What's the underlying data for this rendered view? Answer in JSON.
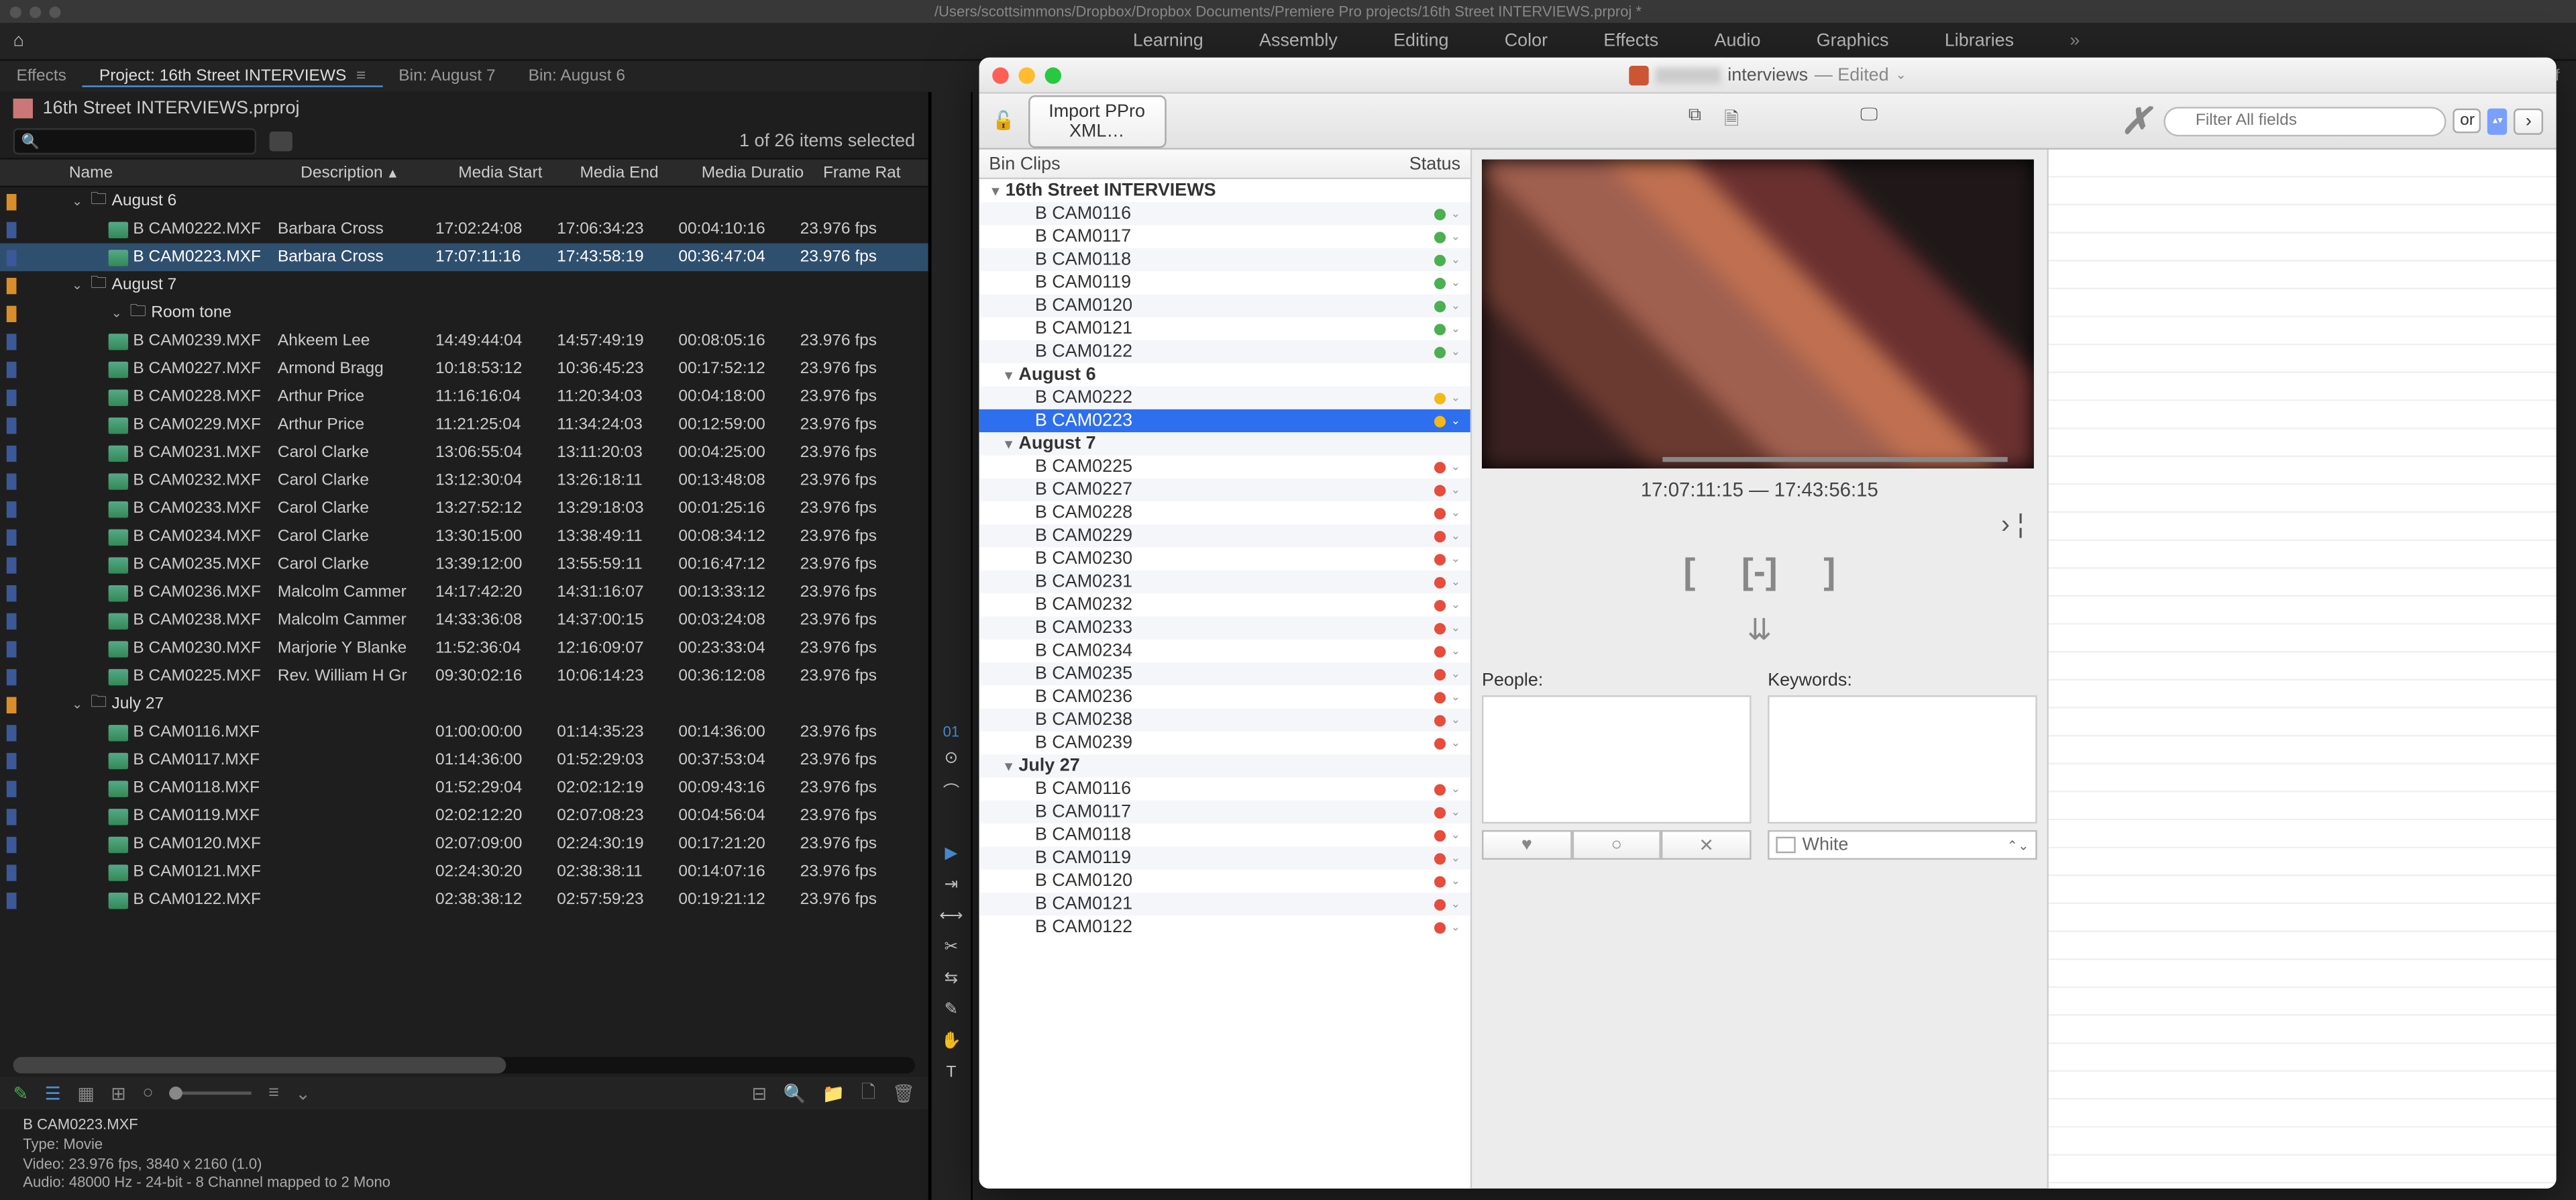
{
  "mac_title": "/Users/scottsimmons/Dropbox/Dropbox Documents/Premiere Pro projects/16th Street INTERVIEWS.prproj *",
  "nav": {
    "items": [
      "Learning",
      "Assembly",
      "Editing",
      "Color",
      "Effects",
      "Audio",
      "Graphics",
      "Libraries"
    ]
  },
  "tabs": {
    "effects": "Effects",
    "project": "Project: 16th Street INTERVIEWS",
    "bin1": "Bin: August 7",
    "bin2": "Bin: August 6",
    "eff_right": "Eff"
  },
  "project_name": "16th Street INTERVIEWS.prproj",
  "selection": "1 of 26 items selected",
  "columns": {
    "name": "Name",
    "desc": "Description",
    "start": "Media Start",
    "end": "Media End",
    "dur": "Media Duratio",
    "rate": "Frame Rat"
  },
  "rows": [
    {
      "type": "folder",
      "depth": 1,
      "name": "August 6",
      "label": "orange"
    },
    {
      "type": "clip",
      "depth": 2,
      "name": "B CAM0222.MXF",
      "desc": "Barbara Cross",
      "start": "17:02:24:08",
      "end": "17:06:34:23",
      "dur": "00:04:10:16",
      "rate": "23.976 fps"
    },
    {
      "type": "clip",
      "depth": 2,
      "name": "B CAM0223.MXF",
      "desc": "Barbara Cross",
      "start": "17:07:11:16",
      "end": "17:43:58:19",
      "dur": "00:36:47:04",
      "rate": "23.976 fps",
      "selected": true
    },
    {
      "type": "folder",
      "depth": 1,
      "name": "August 7",
      "label": "orange"
    },
    {
      "type": "folder",
      "depth": 2,
      "name": "Room tone",
      "label": "orange"
    },
    {
      "type": "clip",
      "depth": 2,
      "name": "B CAM0239.MXF",
      "desc": "Ahkeem Lee",
      "start": "14:49:44:04",
      "end": "14:57:49:19",
      "dur": "00:08:05:16",
      "rate": "23.976 fps"
    },
    {
      "type": "clip",
      "depth": 2,
      "name": "B CAM0227.MXF",
      "desc": "Armond Bragg",
      "start": "10:18:53:12",
      "end": "10:36:45:23",
      "dur": "00:17:52:12",
      "rate": "23.976 fps"
    },
    {
      "type": "clip",
      "depth": 2,
      "name": "B CAM0228.MXF",
      "desc": "Arthur Price",
      "start": "11:16:16:04",
      "end": "11:20:34:03",
      "dur": "00:04:18:00",
      "rate": "23.976 fps"
    },
    {
      "type": "clip",
      "depth": 2,
      "name": "B CAM0229.MXF",
      "desc": "Arthur Price",
      "start": "11:21:25:04",
      "end": "11:34:24:03",
      "dur": "00:12:59:00",
      "rate": "23.976 fps"
    },
    {
      "type": "clip",
      "depth": 2,
      "name": "B CAM0231.MXF",
      "desc": "Carol Clarke",
      "start": "13:06:55:04",
      "end": "13:11:20:03",
      "dur": "00:04:25:00",
      "rate": "23.976 fps"
    },
    {
      "type": "clip",
      "depth": 2,
      "name": "B CAM0232.MXF",
      "desc": "Carol Clarke",
      "start": "13:12:30:04",
      "end": "13:26:18:11",
      "dur": "00:13:48:08",
      "rate": "23.976 fps"
    },
    {
      "type": "clip",
      "depth": 2,
      "name": "B CAM0233.MXF",
      "desc": "Carol Clarke",
      "start": "13:27:52:12",
      "end": "13:29:18:03",
      "dur": "00:01:25:16",
      "rate": "23.976 fps"
    },
    {
      "type": "clip",
      "depth": 2,
      "name": "B CAM0234.MXF",
      "desc": "Carol Clarke",
      "start": "13:30:15:00",
      "end": "13:38:49:11",
      "dur": "00:08:34:12",
      "rate": "23.976 fps"
    },
    {
      "type": "clip",
      "depth": 2,
      "name": "B CAM0235.MXF",
      "desc": "Carol Clarke",
      "start": "13:39:12:00",
      "end": "13:55:59:11",
      "dur": "00:16:47:12",
      "rate": "23.976 fps"
    },
    {
      "type": "clip",
      "depth": 2,
      "name": "B CAM0236.MXF",
      "desc": "Malcolm Cammer",
      "start": "14:17:42:20",
      "end": "14:31:16:07",
      "dur": "00:13:33:12",
      "rate": "23.976 fps"
    },
    {
      "type": "clip",
      "depth": 2,
      "name": "B CAM0238.MXF",
      "desc": "Malcolm Cammer",
      "start": "14:33:36:08",
      "end": "14:37:00:15",
      "dur": "00:03:24:08",
      "rate": "23.976 fps"
    },
    {
      "type": "clip",
      "depth": 2,
      "name": "B CAM0230.MXF",
      "desc": "Marjorie Y Blanke",
      "start": "11:52:36:04",
      "end": "12:16:09:07",
      "dur": "00:23:33:04",
      "rate": "23.976 fps"
    },
    {
      "type": "clip",
      "depth": 2,
      "name": "B CAM0225.MXF",
      "desc": "Rev. William H Gr",
      "start": "09:30:02:16",
      "end": "10:06:14:23",
      "dur": "00:36:12:08",
      "rate": "23.976 fps"
    },
    {
      "type": "folder",
      "depth": 1,
      "name": "July 27",
      "label": "orange"
    },
    {
      "type": "clip",
      "depth": 2,
      "name": "B CAM0116.MXF",
      "desc": "",
      "start": "01:00:00:00",
      "end": "01:14:35:23",
      "dur": "00:14:36:00",
      "rate": "23.976 fps"
    },
    {
      "type": "clip",
      "depth": 2,
      "name": "B CAM0117.MXF",
      "desc": "",
      "start": "01:14:36:00",
      "end": "01:52:29:03",
      "dur": "00:37:53:04",
      "rate": "23.976 fps"
    },
    {
      "type": "clip",
      "depth": 2,
      "name": "B CAM0118.MXF",
      "desc": "",
      "start": "01:52:29:04",
      "end": "02:02:12:19",
      "dur": "00:09:43:16",
      "rate": "23.976 fps"
    },
    {
      "type": "clip",
      "depth": 2,
      "name": "B CAM0119.MXF",
      "desc": "",
      "start": "02:02:12:20",
      "end": "02:07:08:23",
      "dur": "00:04:56:04",
      "rate": "23.976 fps"
    },
    {
      "type": "clip",
      "depth": 2,
      "name": "B CAM0120.MXF",
      "desc": "",
      "start": "02:07:09:00",
      "end": "02:24:30:19",
      "dur": "00:17:21:20",
      "rate": "23.976 fps"
    },
    {
      "type": "clip",
      "depth": 2,
      "name": "B CAM0121.MXF",
      "desc": "",
      "start": "02:24:30:20",
      "end": "02:38:38:11",
      "dur": "00:14:07:16",
      "rate": "23.976 fps"
    },
    {
      "type": "clip",
      "depth": 2,
      "name": "B CAM0122.MXF",
      "desc": "",
      "start": "02:38:38:12",
      "end": "02:57:59:23",
      "dur": "00:19:21:12",
      "rate": "23.976 fps"
    }
  ],
  "info": {
    "filename": "B CAM0223.MXF",
    "type": "Type:  Movie",
    "video": "Video:  23.976 fps, 3840 x 2160 (1.0)",
    "audio": "Audio:  48000 Hz - 24-bit - 8 Channel mapped to 2 Mono"
  },
  "timeline_tc": "01",
  "float": {
    "title": "interviews",
    "edited": "— Edited",
    "import_btn": "Import PPro XML…",
    "search_placeholder": "Filter All fields",
    "or": "or",
    "clips_header": "Bin Clips",
    "status_header": "Status",
    "tree": [
      {
        "d": 0,
        "tw": "▼",
        "label": "16th Street INTERVIEWS",
        "bold": true
      },
      {
        "d": 1,
        "label": "B CAM0116",
        "stat": "g"
      },
      {
        "d": 1,
        "label": "B CAM0117",
        "stat": "g"
      },
      {
        "d": 1,
        "label": "B CAM0118",
        "stat": "g"
      },
      {
        "d": 1,
        "label": "B CAM0119",
        "stat": "g"
      },
      {
        "d": 1,
        "label": "B CAM0120",
        "stat": "g"
      },
      {
        "d": 1,
        "label": "B CAM0121",
        "stat": "g"
      },
      {
        "d": 1,
        "label": "B CAM0122",
        "stat": "g"
      },
      {
        "d": 0,
        "tw": "▼",
        "label": "August 6",
        "bold": true,
        "ind": 1
      },
      {
        "d": 1,
        "label": "B CAM0222",
        "stat": "y"
      },
      {
        "d": 1,
        "label": "B CAM0223",
        "stat": "y",
        "sel": true
      },
      {
        "d": 0,
        "tw": "▼",
        "label": "August 7",
        "bold": true,
        "ind": 1
      },
      {
        "d": 1,
        "label": "B CAM0225",
        "stat": "r"
      },
      {
        "d": 1,
        "label": "B CAM0227",
        "stat": "r"
      },
      {
        "d": 1,
        "label": "B CAM0228",
        "stat": "r"
      },
      {
        "d": 1,
        "label": "B CAM0229",
        "stat": "r"
      },
      {
        "d": 1,
        "label": "B CAM0230",
        "stat": "r"
      },
      {
        "d": 1,
        "label": "B CAM0231",
        "stat": "r"
      },
      {
        "d": 1,
        "label": "B CAM0232",
        "stat": "r"
      },
      {
        "d": 1,
        "label": "B CAM0233",
        "stat": "r"
      },
      {
        "d": 1,
        "label": "B CAM0234",
        "stat": "r"
      },
      {
        "d": 1,
        "label": "B CAM0235",
        "stat": "r"
      },
      {
        "d": 1,
        "label": "B CAM0236",
        "stat": "r"
      },
      {
        "d": 1,
        "label": "B CAM0238",
        "stat": "r"
      },
      {
        "d": 1,
        "label": "B CAM0239",
        "stat": "r"
      },
      {
        "d": 0,
        "tw": "▼",
        "label": "July 27",
        "bold": true,
        "ind": 1
      },
      {
        "d": 1,
        "label": "B CAM0116",
        "stat": "r"
      },
      {
        "d": 1,
        "label": "B CAM0117",
        "stat": "r"
      },
      {
        "d": 1,
        "label": "B CAM0118",
        "stat": "r"
      },
      {
        "d": 1,
        "label": "B CAM0119",
        "stat": "r"
      },
      {
        "d": 1,
        "label": "B CAM0120",
        "stat": "r"
      },
      {
        "d": 1,
        "label": "B CAM0121",
        "stat": "r"
      },
      {
        "d": 1,
        "label": "B CAM0122",
        "stat": "r"
      }
    ],
    "timecode": "17:07:11:15 — 17:43:56:15",
    "people_label": "People:",
    "keywords_label": "Keywords:",
    "color_value": "White"
  }
}
